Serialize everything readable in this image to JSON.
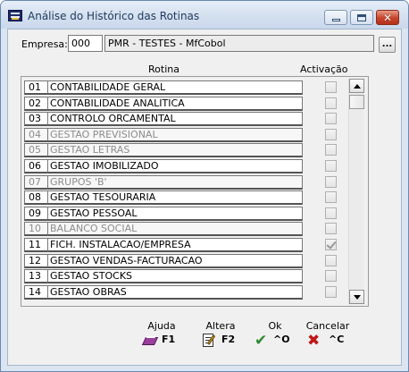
{
  "window": {
    "title": "Análise do Histórico das Rotinas",
    "controls": {
      "minimize": "minimize-icon",
      "maximize": "maximize-icon",
      "close": "close-icon"
    }
  },
  "empresa": {
    "label": "Empresa:",
    "code": "000",
    "name": "PMR - TESTES - MfCobol",
    "lookup_label": "..."
  },
  "headers": {
    "rotina": "Rotina",
    "activacao": "Activação"
  },
  "rows": [
    {
      "num": "01",
      "name": "CONTABILIDADE GERAL",
      "enabled": true,
      "checked": false
    },
    {
      "num": "02",
      "name": "CONTABILIDADE ANALITICA",
      "enabled": true,
      "checked": false
    },
    {
      "num": "03",
      "name": "CONTROLO ORCAMENTAL",
      "enabled": true,
      "checked": false
    },
    {
      "num": "04",
      "name": "GESTAO PREVISIONAL",
      "enabled": false,
      "checked": false
    },
    {
      "num": "05",
      "name": "GESTAO LETRAS",
      "enabled": false,
      "checked": false
    },
    {
      "num": "06",
      "name": "GESTAO IMOBILIZADO",
      "enabled": true,
      "checked": false
    },
    {
      "num": "07",
      "name": "GRUPOS 'B'",
      "enabled": false,
      "checked": false
    },
    {
      "num": "08",
      "name": "GESTAO TESOURARIA",
      "enabled": true,
      "checked": false
    },
    {
      "num": "09",
      "name": "GESTAO PESSOAL",
      "enabled": true,
      "checked": false
    },
    {
      "num": "10",
      "name": "BALANCO SOCIAL",
      "enabled": false,
      "checked": false
    },
    {
      "num": "11",
      "name": "FICH. INSTALACAO/EMPRESA",
      "enabled": true,
      "checked": true
    },
    {
      "num": "12",
      "name": "GESTAO VENDAS-FACTURACAO",
      "enabled": true,
      "checked": false
    },
    {
      "num": "13",
      "name": "GESTAO STOCKS",
      "enabled": true,
      "checked": false
    },
    {
      "num": "14",
      "name": "GESTAO OBRAS",
      "enabled": true,
      "checked": false
    }
  ],
  "function_keys": [
    {
      "id": "ajuda",
      "label": "Ajuda",
      "key": "F1",
      "icon": "help-book-icon"
    },
    {
      "id": "altera",
      "label": "Altera",
      "key": "F2",
      "icon": "edit-icon"
    },
    {
      "id": "ok",
      "label": "Ok",
      "key": "^O",
      "icon": "checkmark-icon"
    },
    {
      "id": "cancelar",
      "label": "Cancelar",
      "key": "^C",
      "icon": "cancel-x-icon"
    }
  ],
  "colors": {
    "title_text": "#1e395b",
    "disabled_text": "#8c8c8c",
    "ok_green": "#2d8a2d",
    "cancel_red": "#c01818",
    "help_purple": "#9b3f9c"
  }
}
